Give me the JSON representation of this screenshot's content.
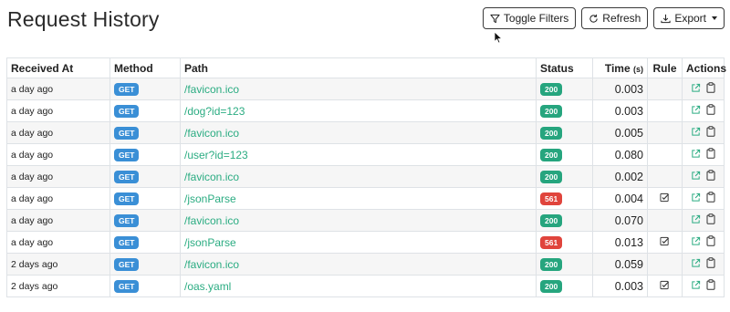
{
  "header": {
    "title": "Request History",
    "buttons": {
      "toggle_filters": "Toggle Filters",
      "refresh": "Refresh",
      "export": "Export"
    }
  },
  "table": {
    "columns": {
      "received_at": "Received At",
      "method": "Method",
      "path": "Path",
      "status": "Status",
      "time": "Time",
      "time_unit": "(s)",
      "rule": "Rule",
      "actions": "Actions"
    },
    "rows": [
      {
        "received": "a day ago",
        "method": "GET",
        "path": "/favicon.ico",
        "status": "200",
        "time": "0.003",
        "rule": false
      },
      {
        "received": "a day ago",
        "method": "GET",
        "path": "/dog?id=123",
        "status": "200",
        "time": "0.003",
        "rule": false
      },
      {
        "received": "a day ago",
        "method": "GET",
        "path": "/favicon.ico",
        "status": "200",
        "time": "0.005",
        "rule": false
      },
      {
        "received": "a day ago",
        "method": "GET",
        "path": "/user?id=123",
        "status": "200",
        "time": "0.080",
        "rule": false
      },
      {
        "received": "a day ago",
        "method": "GET",
        "path": "/favicon.ico",
        "status": "200",
        "time": "0.002",
        "rule": false
      },
      {
        "received": "a day ago",
        "method": "GET",
        "path": "/jsonParse",
        "status": "561",
        "time": "0.004",
        "rule": true
      },
      {
        "received": "a day ago",
        "method": "GET",
        "path": "/favicon.ico",
        "status": "200",
        "time": "0.070",
        "rule": false
      },
      {
        "received": "a day ago",
        "method": "GET",
        "path": "/jsonParse",
        "status": "561",
        "time": "0.013",
        "rule": true
      },
      {
        "received": "2 days ago",
        "method": "GET",
        "path": "/favicon.ico",
        "status": "200",
        "time": "0.059",
        "rule": false
      },
      {
        "received": "2 days ago",
        "method": "GET",
        "path": "/oas.yaml",
        "status": "200",
        "time": "0.003",
        "rule": true
      }
    ]
  },
  "colors": {
    "method_get": "#3a8fd6",
    "status_ok": "#26a57e",
    "status_error": "#e0443c",
    "link": "#2bac82"
  },
  "icons": {
    "filter": "filter-icon",
    "refresh": "refresh-icon",
    "export": "download-icon",
    "open": "external-link-icon",
    "copy": "clipboard-icon",
    "rule": "checkbox-checked-icon"
  }
}
